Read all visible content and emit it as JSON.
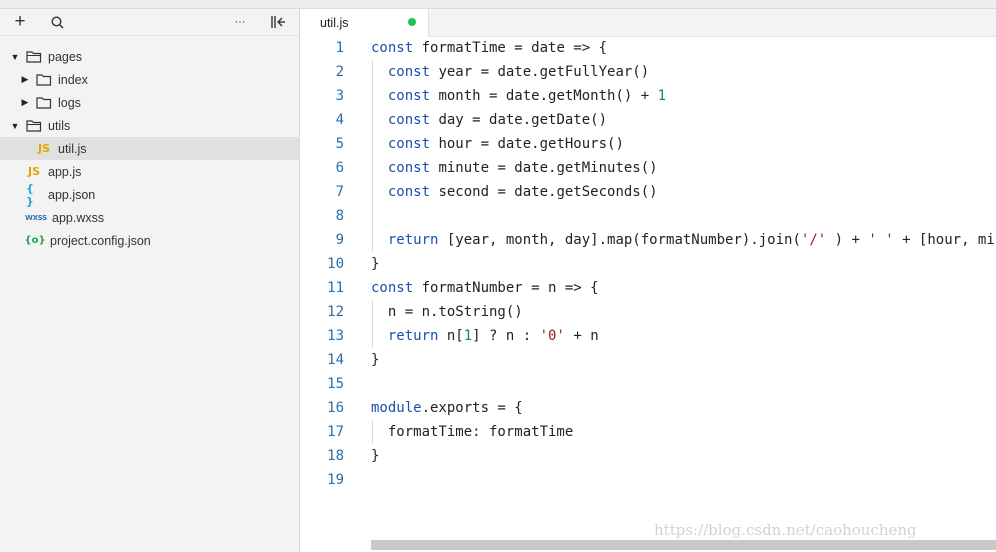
{
  "sidebar": {
    "toolbar": {
      "add": "+",
      "more": "···"
    },
    "tree": [
      {
        "label": "pages"
      },
      {
        "label": "index"
      },
      {
        "label": "logs"
      },
      {
        "label": "utils"
      },
      {
        "label": "util.js",
        "badge": "JS"
      },
      {
        "label": "app.js",
        "badge": "JS"
      },
      {
        "label": "app.json",
        "badge": "{ }"
      },
      {
        "label": "app.wxss",
        "badge": "WXSS"
      },
      {
        "label": "project.config.json",
        "badge": "{o}"
      }
    ]
  },
  "editor": {
    "tab": {
      "label": "util.js",
      "modified_color": "#20c05c"
    },
    "lines": [
      {
        "n": "1",
        "t": [
          [
            "kw",
            "const"
          ],
          [
            "",
            "formatTime = date => {"
          ]
        ]
      },
      {
        "n": "2",
        "t": [
          [
            "",
            "  "
          ],
          [
            "kw",
            "const"
          ],
          [
            "",
            "year = date.getFullYear()"
          ]
        ]
      },
      {
        "n": "3",
        "t": [
          [
            "",
            "  "
          ],
          [
            "kw",
            "const"
          ],
          [
            "",
            "month = date.getMonth() + "
          ],
          [
            "num",
            "1"
          ]
        ]
      },
      {
        "n": "4",
        "t": [
          [
            "",
            "  "
          ],
          [
            "kw",
            "const"
          ],
          [
            "",
            "day = date.getDate()"
          ]
        ]
      },
      {
        "n": "5",
        "t": [
          [
            "",
            "  "
          ],
          [
            "kw",
            "const"
          ],
          [
            "",
            "hour = date.getHours()"
          ]
        ]
      },
      {
        "n": "6",
        "t": [
          [
            "",
            "  "
          ],
          [
            "kw",
            "const"
          ],
          [
            "",
            "minute = date.getMinutes()"
          ]
        ]
      },
      {
        "n": "7",
        "t": [
          [
            "",
            "  "
          ],
          [
            "kw",
            "const"
          ],
          [
            "",
            "second = date.getSeconds()"
          ]
        ]
      },
      {
        "n": "8",
        "t": []
      },
      {
        "n": "9",
        "t": [
          [
            "",
            "  "
          ],
          [
            "kw",
            "return"
          ],
          [
            "",
            "[year, month, day].map(formatNumber).join("
          ],
          [
            "str",
            "'/'"
          ],
          [
            "",
            " ) + "
          ],
          [
            "str",
            "' '"
          ],
          [
            "",
            " + [hour, minute, second].map(formatNumber).join("
          ],
          [
            "str",
            "':'"
          ],
          [
            "",
            ")"
          ]
        ]
      },
      {
        "n": "10",
        "t": [
          [
            "",
            "}"
          ]
        ]
      },
      {
        "n": "11",
        "t": [
          [
            "kw",
            "const"
          ],
          [
            "",
            "formatNumber = n => {"
          ]
        ]
      },
      {
        "n": "12",
        "t": [
          [
            "",
            "  n = n.toString()"
          ]
        ]
      },
      {
        "n": "13",
        "t": [
          [
            "",
            "  "
          ],
          [
            "kw",
            "return"
          ],
          [
            "",
            "n["
          ],
          [
            "num",
            "1"
          ],
          [
            "",
            "] ? n : "
          ],
          [
            "str",
            "'0'"
          ],
          [
            "",
            " + n"
          ]
        ]
      },
      {
        "n": "14",
        "t": [
          [
            "",
            "}"
          ]
        ]
      },
      {
        "n": "15",
        "t": []
      },
      {
        "n": "16",
        "t": [
          [
            "kw",
            "module"
          ],
          [
            "",
            ".exports = {"
          ]
        ]
      },
      {
        "n": "17",
        "t": [
          [
            "",
            "  formatTime: formatTime"
          ]
        ]
      },
      {
        "n": "18",
        "t": [
          [
            "",
            "}"
          ]
        ]
      },
      {
        "n": "19",
        "t": []
      }
    ]
  },
  "watermark": "https://blog.csdn.net/caohoucheng"
}
